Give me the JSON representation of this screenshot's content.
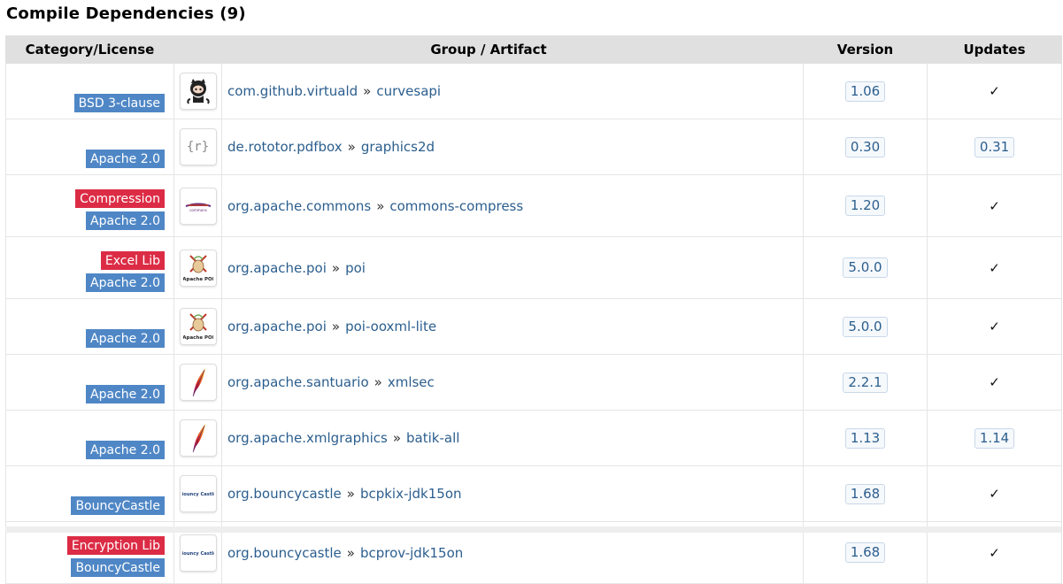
{
  "section": {
    "title": "Compile Dependencies (9)"
  },
  "table": {
    "headers": {
      "category": "Category/License",
      "artifact": "Group / Artifact",
      "version": "Version",
      "updates": "Updates"
    },
    "rows": [
      {
        "categories": [],
        "license": "BSD 3-clause",
        "logo": "github-octocat-icon",
        "group": "com.github.virtuald",
        "artifact": "curvesapi",
        "version": "1.06",
        "update": "✓"
      },
      {
        "categories": [],
        "license": "Apache 2.0",
        "logo": "rototor-icon",
        "group": "de.rototor.pdfbox",
        "artifact": "graphics2d",
        "version": "0.30",
        "update": "0.31"
      },
      {
        "categories": [
          "Compression"
        ],
        "license": "Apache 2.0",
        "logo": "apache-commons-icon",
        "group": "org.apache.commons",
        "artifact": "commons-compress",
        "version": "1.20",
        "update": "✓"
      },
      {
        "categories": [
          "Excel Lib"
        ],
        "license": "Apache 2.0",
        "logo": "apache-poi-icon",
        "group": "org.apache.poi",
        "artifact": "poi",
        "version": "5.0.0",
        "update": "✓"
      },
      {
        "categories": [],
        "license": "Apache 2.0",
        "logo": "apache-poi-icon",
        "group": "org.apache.poi",
        "artifact": "poi-ooxml-lite",
        "version": "5.0.0",
        "update": "✓"
      },
      {
        "categories": [],
        "license": "Apache 2.0",
        "logo": "apache-feather-icon",
        "group": "org.apache.santuario",
        "artifact": "xmlsec",
        "version": "2.2.1",
        "update": "✓"
      },
      {
        "categories": [],
        "license": "Apache 2.0",
        "logo": "apache-feather-icon",
        "group": "org.apache.xmlgraphics",
        "artifact": "batik-all",
        "version": "1.13",
        "update": "1.14"
      },
      {
        "categories": [],
        "license": "BouncyCastle",
        "logo": "bouncy-castle-icon",
        "group": "org.bouncycastle",
        "artifact": "bcpkix-jdk15on",
        "version": "1.68",
        "update": "✓"
      },
      {
        "categories": [
          "Encryption Lib"
        ],
        "license": "BouncyCastle",
        "logo": "bouncy-castle-icon",
        "group": "org.bouncycastle",
        "artifact": "bcprov-jdk15on",
        "version": "1.68",
        "update": "✓"
      }
    ],
    "separator": "»",
    "logo_texts": {
      "rototor": "{r}",
      "apache_poi": "Apache POI",
      "bouncy_castle": "Bouncy Castle"
    }
  },
  "colors": {
    "license_badge": "#4f87c6",
    "category_badge": "#dc2c45",
    "link": "#2b5e8e",
    "header_bg": "#e0e0e0"
  }
}
